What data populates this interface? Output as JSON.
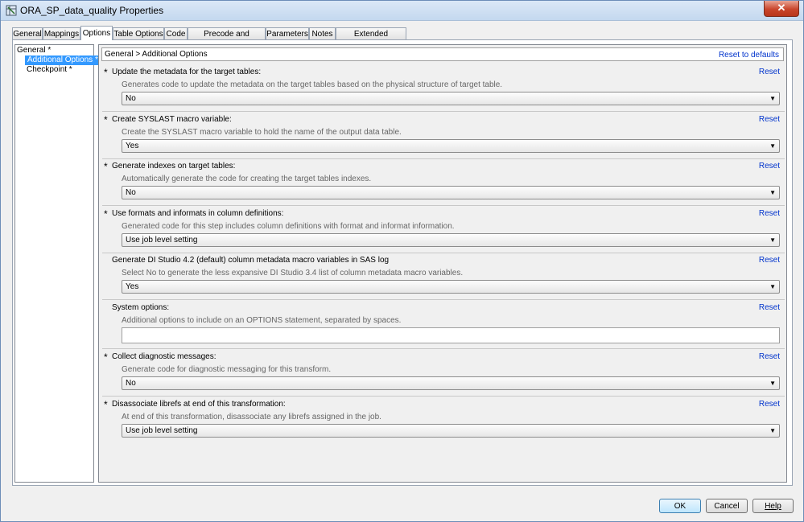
{
  "window": {
    "title": "ORA_SP_data_quality Properties",
    "close_glyph": "✕"
  },
  "tabs": [
    {
      "label": "General"
    },
    {
      "label": "Mappings"
    },
    {
      "label": "Options"
    },
    {
      "label": "Table Options"
    },
    {
      "label": "Code"
    },
    {
      "label": "Precode and Postcode"
    },
    {
      "label": "Parameters"
    },
    {
      "label": "Notes"
    },
    {
      "label": "Extended Attributes"
    }
  ],
  "active_tab": "Options",
  "tree": {
    "root": "General *",
    "items": [
      "Additional Options *",
      "Checkpoint *"
    ],
    "selected": "Additional Options *"
  },
  "content": {
    "breadcrumb": "General > Additional Options",
    "reset_defaults": "Reset to defaults",
    "reset_label": "Reset",
    "sections": [
      {
        "required": "*",
        "label": "Update the metadata for the target tables:",
        "desc": "Generates code to update the metadata on the target tables based on the physical structure of target table.",
        "value": "No"
      },
      {
        "required": "*",
        "label": "Create SYSLAST macro variable:",
        "desc": "Create the SYSLAST macro variable to hold the name of the output data table.",
        "value": "Yes"
      },
      {
        "required": "*",
        "label": "Generate indexes on target tables:",
        "desc": "Automatically generate the code for creating the target tables indexes.",
        "value": "No"
      },
      {
        "required": "*",
        "label": "Use formats and informats in column definitions:",
        "desc": "Generated code for this step includes column definitions with format and informat information.",
        "value": "Use job level setting"
      },
      {
        "required": "",
        "label": "Generate DI Studio 4.2 (default) column metadata macro variables in SAS log",
        "desc": "Select No to generate the less expansive DI Studio 3.4 list of column metadata macro variables.",
        "value": "Yes"
      },
      {
        "required": "",
        "label": "System options:",
        "desc": "Additional options to include on an OPTIONS statement, separated by spaces.",
        "value": ""
      },
      {
        "required": "*",
        "label": "Collect diagnostic messages:",
        "desc": "Generate code for diagnostic messaging for this transform.",
        "value": "No"
      },
      {
        "required": "*",
        "label": "Disassociate librefs at end of this transformation:",
        "desc": "At end of this transformation, disassociate any librefs assigned in the job.",
        "value": "Use job level setting"
      }
    ]
  },
  "buttons": {
    "ok": "OK",
    "cancel": "Cancel",
    "help": "Help"
  },
  "icons": {
    "dropdown": "chevron-down-icon",
    "arrow_glyph": "▼"
  }
}
